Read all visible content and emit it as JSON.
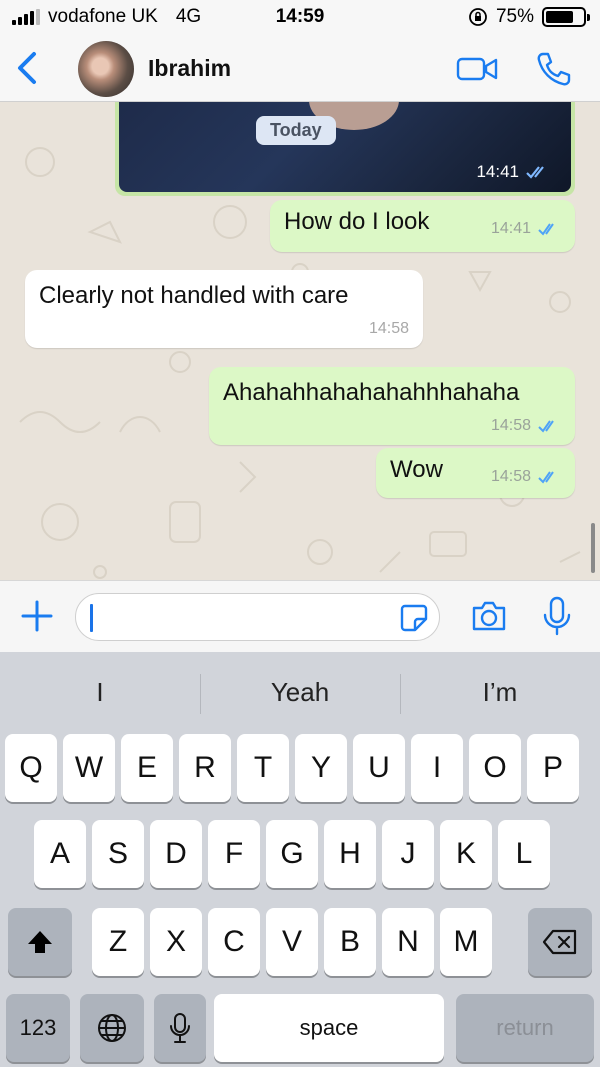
{
  "status_bar": {
    "carrier": "vodafone UK",
    "network": "4G",
    "time": "14:59",
    "battery": "75%",
    "battery_level": 0.75,
    "lock_icon": "orientation-lock-icon"
  },
  "header": {
    "contact_name": "Ibrahim",
    "icons": [
      "back-chevron-icon",
      "video-call-icon",
      "phone-icon"
    ]
  },
  "chat": {
    "photo_time": "14:41",
    "date_chip": "Today",
    "messages": [
      {
        "direction": "out",
        "text": "How do I look",
        "time": "14:41",
        "status": "read"
      },
      {
        "direction": "in",
        "text": "Clearly not handled with care",
        "time": "14:58"
      },
      {
        "direction": "out",
        "text": "Ahahahhahahahahhhahaha",
        "time": "14:58",
        "status": "read"
      },
      {
        "direction": "out",
        "text": "Wow",
        "time": "14:58",
        "status": "read"
      }
    ]
  },
  "input_bar": {
    "placeholder": "",
    "icons": [
      "plus-icon",
      "sticker-icon",
      "camera-icon",
      "microphone-icon"
    ]
  },
  "keyboard": {
    "suggestions": [
      "I",
      "Yeah",
      "I’m"
    ],
    "row1": [
      "Q",
      "W",
      "E",
      "R",
      "T",
      "Y",
      "U",
      "I",
      "O",
      "P"
    ],
    "row2": [
      "A",
      "S",
      "D",
      "F",
      "G",
      "H",
      "J",
      "K",
      "L"
    ],
    "row3": [
      "Z",
      "X",
      "C",
      "V",
      "B",
      "N",
      "M"
    ],
    "numbers_label": "123",
    "space_label": "space",
    "return_label": "return",
    "icons": [
      "shift-icon",
      "delete-icon",
      "globe-icon",
      "dictation-icon"
    ]
  },
  "colors": {
    "accent": "#1a7cf0",
    "outgoing_bubble": "#dcf8c6",
    "incoming_bubble": "#ffffff",
    "chat_background": "#e9e3da",
    "read_ticks": "#4fa3f7"
  }
}
